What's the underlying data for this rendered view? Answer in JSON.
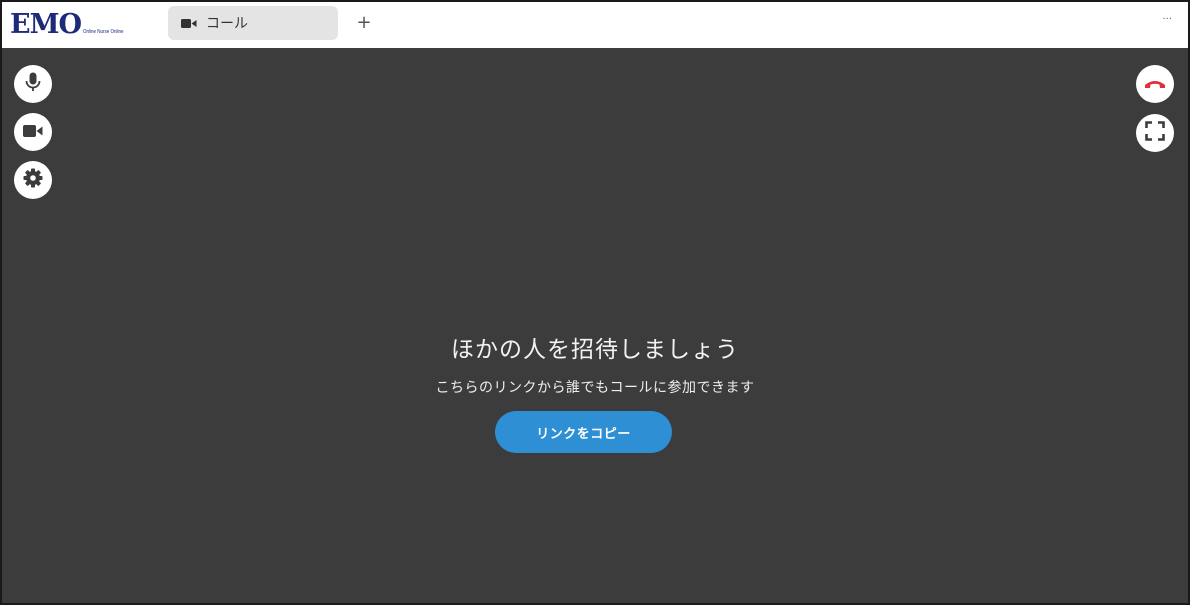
{
  "app": {
    "logo_text": "EMO",
    "logo_subtext": "Online Nurse Online"
  },
  "tabs": [
    {
      "label": "コール",
      "icon": "video-camera-icon",
      "active": true
    }
  ],
  "toolbar": {
    "new_tab_label": "+",
    "more_label": "···"
  },
  "controls": {
    "left": [
      {
        "icon": "microphone-icon"
      },
      {
        "icon": "video-camera-icon"
      },
      {
        "icon": "gear-icon"
      }
    ],
    "right": [
      {
        "icon": "hang-up-icon",
        "color": "#e0303a"
      },
      {
        "icon": "fullscreen-icon"
      }
    ]
  },
  "invite": {
    "title": "ほかの人を招待しましょう",
    "subtitle": "こちらのリンクから誰でもコールに参加できます",
    "copy_button_label": "リンクをコピー"
  },
  "colors": {
    "stage_background": "#3c3c3c",
    "accent": "#2f8fd4",
    "logo": "#1d2a7a",
    "hang_up": "#e0303a"
  }
}
